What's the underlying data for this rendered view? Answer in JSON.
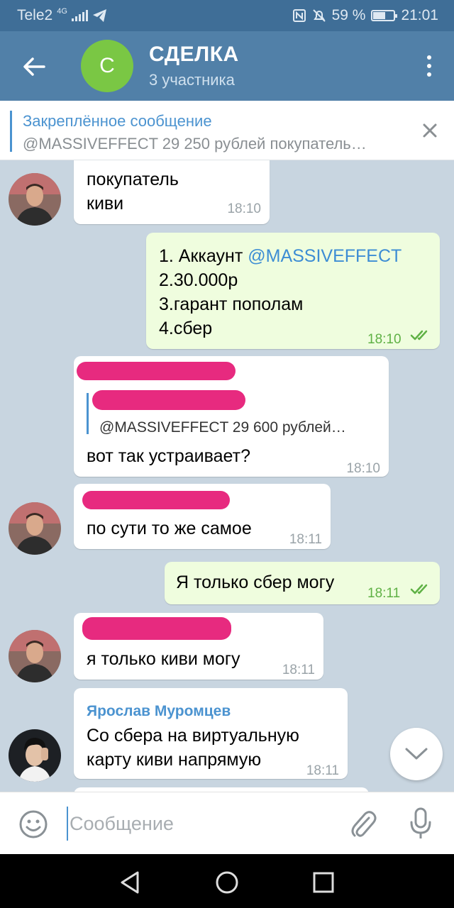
{
  "status_bar": {
    "carrier": "Tele2",
    "network": "4G",
    "battery": "59 %",
    "time": "21:01"
  },
  "header": {
    "avatar_letter": "С",
    "title": "СДЕЛКА",
    "subtitle": "3 участника",
    "avatar_color": "#7ac744"
  },
  "pinned": {
    "title": "Закреплённое сообщение",
    "text": "@MASSIVEFFECT  29 250 рублей  покупатель…"
  },
  "messages": {
    "m1": {
      "lines": [
        "покупатель",
        "киви"
      ],
      "time": "18:10"
    },
    "m2": {
      "mention": "@MASSIVEFFECT",
      "line1_prefix": "1. Аккаунт ",
      "lines": [
        "2.30.000р",
        "3.гарант пополам",
        "4.сбер"
      ],
      "time": "18:10"
    },
    "m3": {
      "reply_text": "@MASSIVEFFECT  29 600 рублей…",
      "text": "вот так устраивает?",
      "time": "18:10"
    },
    "m4": {
      "text": "по сути то же самое",
      "time": "18:11"
    },
    "m5": {
      "text": "Я только сбер могу",
      "time": "18:11"
    },
    "m6": {
      "text": "я только киви могу",
      "time": "18:11"
    },
    "m7": {
      "sender": "Ярослав Муромцев",
      "lines": [
        "Со сбера на виртуальную",
        "карту киви напрямую"
      ],
      "time": "18:11"
    }
  },
  "input": {
    "placeholder": "Сообщение"
  },
  "colors": {
    "header_bg": "#5180a8",
    "accent": "#4b93d0",
    "outgoing_bubble": "#effdde",
    "redaction": "#e72a7f"
  }
}
